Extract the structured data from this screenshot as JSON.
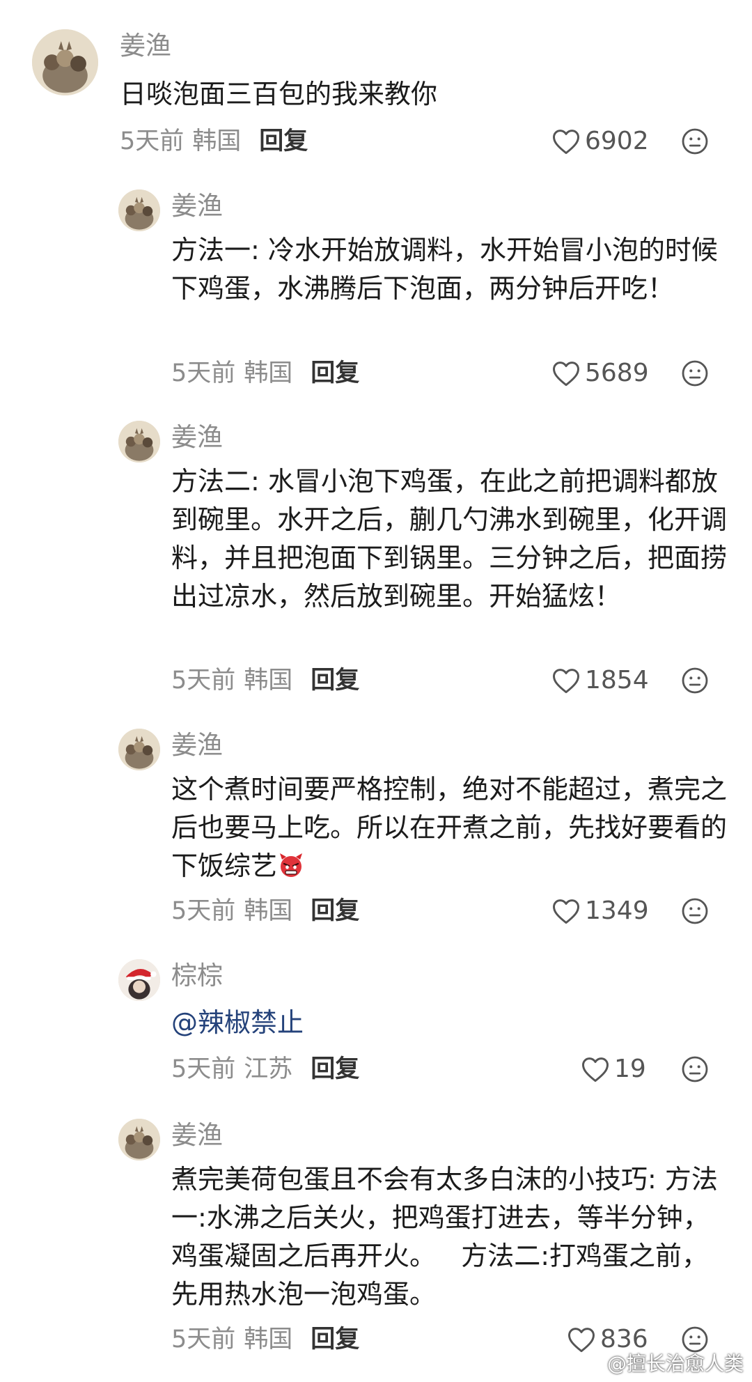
{
  "comments": [
    {
      "username": "姜渔",
      "text": "日啖泡面三百包的我来教你",
      "time": "5天前",
      "location": "韩国",
      "reply_label": "回复",
      "likes": "6902",
      "avatar": "cats-group-avatar"
    },
    {
      "username": "姜渔",
      "text": "方法一: 冷水开始放调料，水开始冒小泡的时候下鸡蛋，水沸腾后下泡面，两分钟后开吃！",
      "time": "5天前",
      "location": "韩国",
      "reply_label": "回复",
      "likes": "5689",
      "avatar": "cats-group-avatar"
    },
    {
      "username": "姜渔",
      "text": "方法二: 水冒小泡下鸡蛋，在此之前把调料都放到碗里。水开之后，蒯几勺沸水到碗里，化开调料，并且把泡面下到锅里。三分钟之后，把面捞出过凉水，然后放到碗里。开始猛炫！",
      "time": "5天前",
      "location": "韩国",
      "reply_label": "回复",
      "likes": "1854",
      "avatar": "cats-group-avatar"
    },
    {
      "username": "姜渔",
      "text": "这个煮时间要严格控制，绝对不能超过，煮完之后也要马上吃。所以在开煮之前，先找好要看的下饭综艺",
      "emoji": "angry-devil-emoji",
      "time": "5天前",
      "location": "韩国",
      "reply_label": "回复",
      "likes": "1349",
      "avatar": "cats-group-avatar"
    },
    {
      "username": "棕棕",
      "text": "@辣椒禁止",
      "time": "5天前",
      "location": "江苏",
      "reply_label": "回复",
      "likes": "19",
      "avatar": "santa-hat-avatar"
    },
    {
      "username": "姜渔",
      "text": "煮完美荷包蛋且不会有太多白沫的小技巧: 方法一:水沸之后关火，把鸡蛋打进去，等半分钟，鸡蛋凝固之后再开火。   方法二:打鸡蛋之前，先用热水泡一泡鸡蛋。",
      "time": "5天前",
      "location": "韩国",
      "reply_label": "回复",
      "likes": "836",
      "avatar": "cats-group-avatar"
    }
  ],
  "watermark": "@擅长治愈人类",
  "colors": {
    "meta_gray": "#8c8c8c",
    "mention_blue": "#24427a",
    "text": "#1b1b1b"
  }
}
